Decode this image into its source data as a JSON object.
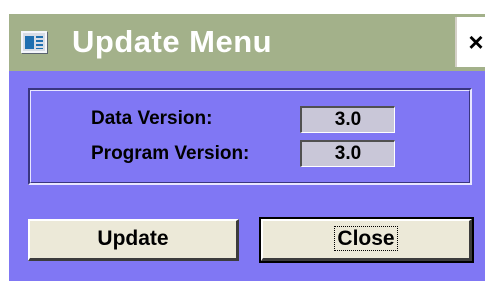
{
  "window": {
    "title": "Update Menu",
    "close_glyph": "×",
    "icon": "window-form-icon"
  },
  "info": {
    "data_version_label": "Data Version:",
    "data_version_value": "3.0",
    "program_version_label": "Program Version:",
    "program_version_value": "3.0"
  },
  "buttons": {
    "update_label": "Update",
    "close_label": "Close"
  },
  "colors": {
    "titlebar": "#a3b18a",
    "client": "#8077f4",
    "button_face": "#ece9d8",
    "value_box": "#c9c7d8"
  }
}
